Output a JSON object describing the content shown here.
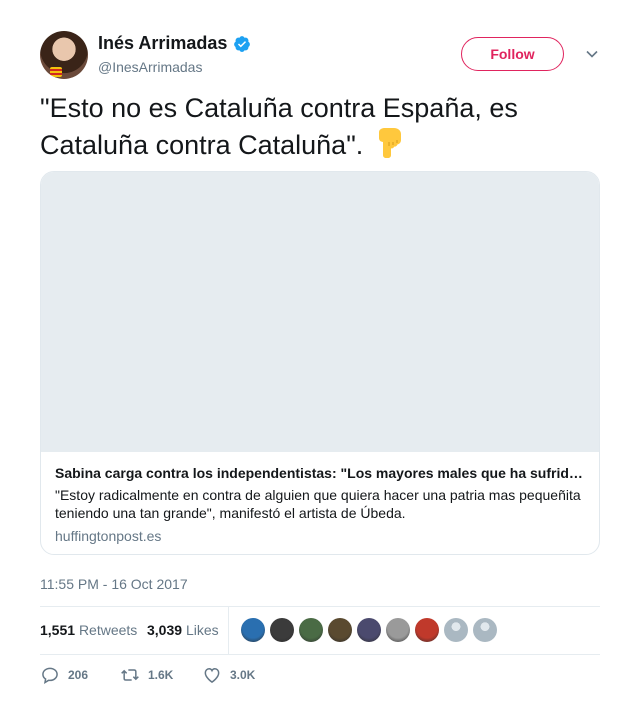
{
  "author": {
    "name": "Inés Arrimadas",
    "handle": "@InesArrimadas",
    "verified": true
  },
  "follow_label": "Follow",
  "tweet_text": "\"Esto no es Cataluña contra España, es Cataluña contra Cataluña\".",
  "emoji": "pointing-down-hand",
  "card": {
    "title": "Sabina carga contra los independentistas: \"Los mayores males que ha sufrido la humanidad\"",
    "description": "\"Estoy radicalmente en contra de alguien que quiera hacer una patria mas pequeñita teniendo una tan grande\", manifestó el artista de Úbeda.",
    "domain": "huffingtonpost.es"
  },
  "timestamp": "11:55 PM - 16 Oct 2017",
  "stats": {
    "retweets_count": "1,551",
    "retweets_label": "Retweets",
    "likes_count": "3,039",
    "likes_label": "Likes"
  },
  "liker_avatar_colors": [
    "#2a6fb0",
    "#3b3b3b",
    "#4a6b45",
    "#5a4a30",
    "#4b4a6e",
    "#9a9a9a",
    "#c0392b",
    "#aab8c2",
    "#aab8c2"
  ],
  "actions": {
    "replies": "206",
    "retweets": "1.6K",
    "likes": "3.0K"
  },
  "colors": {
    "accent": "#e0245e",
    "verified": "#1da1f2",
    "muted": "#657786"
  }
}
